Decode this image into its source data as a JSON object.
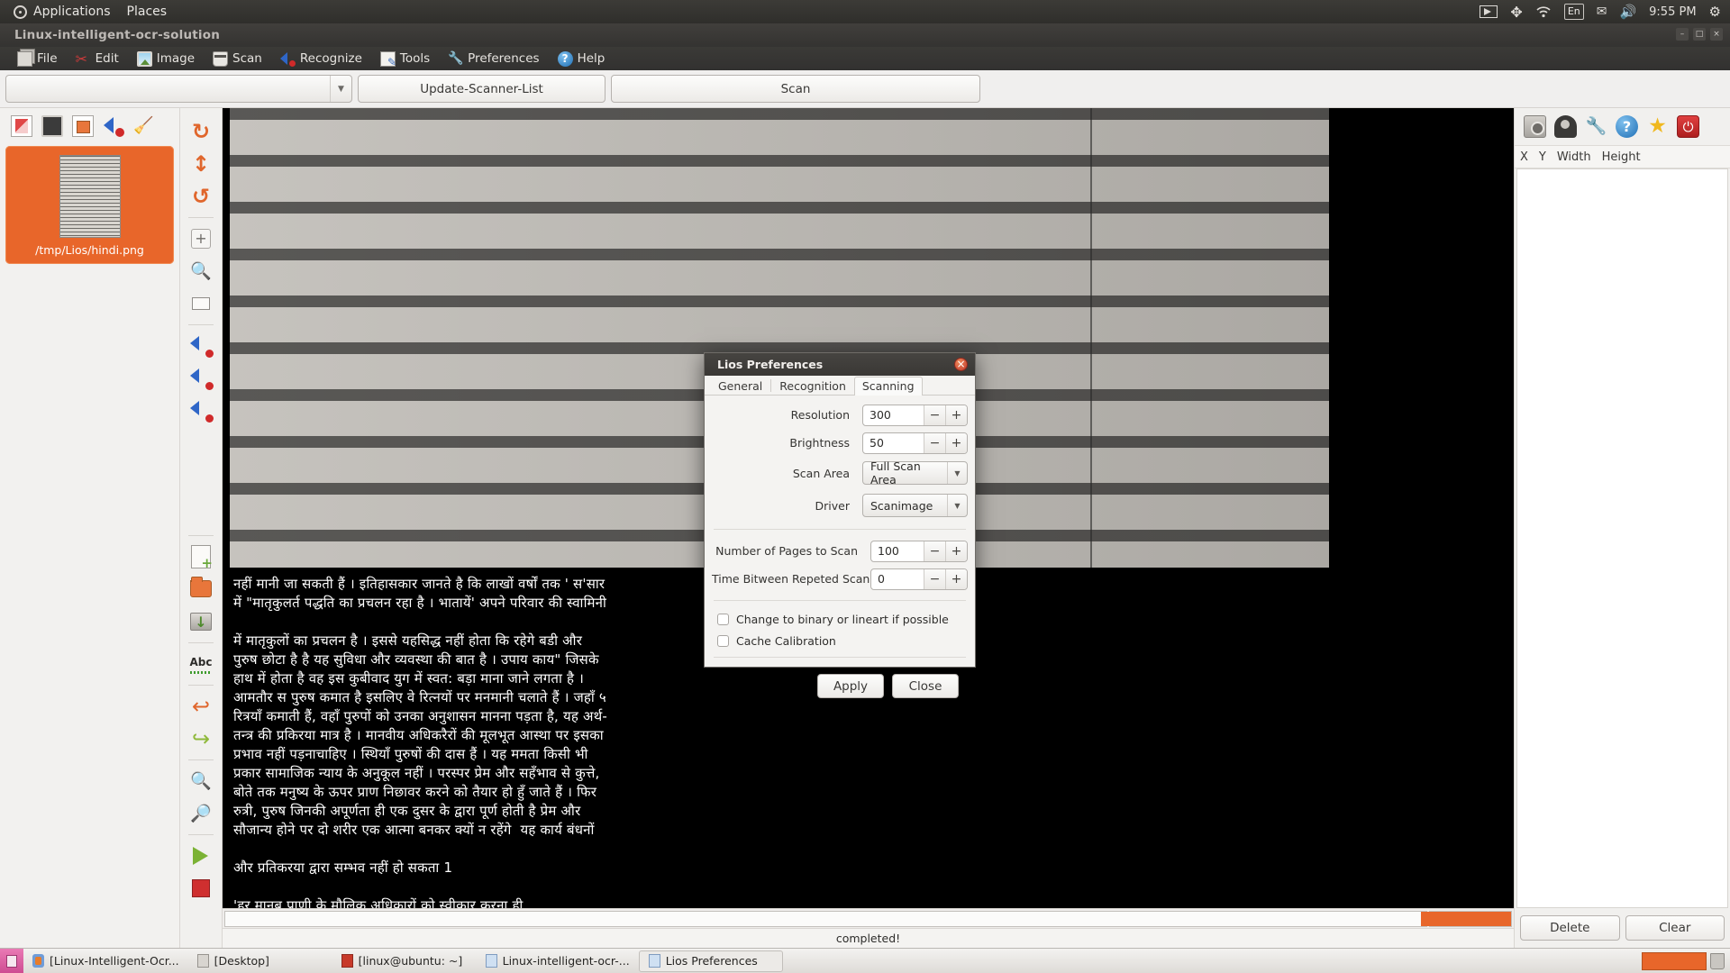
{
  "top_panel": {
    "applications": "Applications",
    "places": "Places",
    "logo_icon": "ubuntu-logo-icon",
    "tray": {
      "media_icon": "media-player-icon",
      "bluetooth_icon": "bluetooth-icon",
      "wifi_icon": "wifi-icon",
      "keyboard_layout": "En",
      "mail_icon": "mail-icon",
      "volume_icon": "volume-icon",
      "clock": "9:55 PM",
      "settings_icon": "gear-icon"
    }
  },
  "window": {
    "title": "Linux-intelligent-ocr-solution",
    "buttons": {
      "minimize": "–",
      "maximize": "□",
      "close": "×"
    }
  },
  "menubar": [
    {
      "label": "File",
      "icon": "file-icon"
    },
    {
      "label": "Edit",
      "icon": "scissors-icon"
    },
    {
      "label": "Image",
      "icon": "image-icon"
    },
    {
      "label": "Scan",
      "icon": "scanner-icon"
    },
    {
      "label": "Recognize",
      "icon": "recognize-icon"
    },
    {
      "label": "Tools",
      "icon": "tools-icon"
    },
    {
      "label": "Preferences",
      "icon": "preferences-icon"
    },
    {
      "label": "Help",
      "icon": "help-icon"
    }
  ],
  "scan_bar": {
    "device_combo_value": "",
    "device_combo_placeholder": "",
    "update_scanner_list": "Update-Scanner-List",
    "scan": "Scan"
  },
  "thumb_panel": {
    "tools": [
      "page-split-icon",
      "black-page-icon",
      "copy-page-icon",
      "recognize-page-icon",
      "clean-icon"
    ],
    "item_label": "/tmp/Lios/hindi.png",
    "item_icon": "page-thumbnail"
  },
  "side_rail": [
    "rotate-right-icon",
    "flip-vertical-icon",
    "rotate-left-icon",
    "add-area-icon",
    "zoom-icon",
    "select-area-icon",
    "recognize-area-icon",
    "recognize-area-2-icon",
    "recognize-area-3-icon",
    "new-document-icon",
    "open-folder-icon",
    "save-icon",
    "spellcheck-icon",
    "undo-icon",
    "redo-icon",
    "find-icon",
    "find-replace-icon",
    "play-icon",
    "stop-icon"
  ],
  "text_view": {
    "content": "नहीं मानी जा सकती हैं । इतिहासकार जानते है कि लाखों वर्षों तक ' स'सार\nमें \"मातृकुलर्त पद्धति का प्रचलन रहा है । भातायें' अपने परिवार की स्वामिनी\n\nमें मातृकुलों का प्रचलन है । इससे यहसिद्ध नहीं होता कि रहेगे बडी और\nपुरुष छोटा है है यह सुविधा और व्यवस्था की बात है । उपाय काय\" जिसके\nहाथ में होता है वह इस कुबीवाद युग में स्वत: बड़ा माना जाने लगता है ।\nआमतौर स पुरुष कमात है इसलिए वे रित्नयों पर मनमानी चलाते हैं । जहाँ ५\nरित्रयाँ कमाती हैं, वहाँ पुरुपों को उनका अनुशासन मानना पड़ता है, यह अर्थ-\nतन्त्र की प्रकिरया मात्र है । मानवीय अधिकरैरों की मूलभूत आस्था पर इसका\nप्रभाव नहीं पड़नाचाहिए । स्थियाँ पुरुषों की दास हैं । यह ममता किसी भी\nप्रकार सामाजिक न्याय के अनुकूल नहीं । परस्पर प्रेम और सहँभाव से कुत्ते,\nबोते तक मनुष्य के ऊपर प्राण निछावर करने को तैयार हो हुँ जाते हैं । फिर\nरुत्री, पुरुष जिनकी अपूर्णता ही एक दुसर के द्वारा पूर्ण होती है प्रेम और\nसौजान्य होने पर दो शरीर एक आत्मा बनकर क्यों न रहेंगे  यह कार्य बंधनों\n\nऔर प्रतिकरया द्वारा सम्भव नहीं हो सकता 1\n\n'हर मानब प्राणी के मौलिक अधिकारों को स्वीकार करना ही\nचाहिए । हर व्यक्ति समान नागरिक अधिकार लेकर जन्मना है इस तथ्य को"
  },
  "right_panel": {
    "tools": [
      "camera-icon",
      "webcam-icon",
      "settings-wrench-icon",
      "help-icon",
      "favorite-star-icon",
      "power-icon"
    ],
    "columns": [
      "X",
      "Y",
      "Width",
      "Height"
    ],
    "rows": [],
    "delete_button": "Delete",
    "clear_button": "Clear"
  },
  "status": {
    "message": "completed!"
  },
  "dialog": {
    "title": "Lios Preferences",
    "close_icon": "close-icon",
    "tabs": [
      {
        "label": "General",
        "active": false
      },
      {
        "label": "Recognition",
        "active": false
      },
      {
        "label": "Scanning",
        "active": true
      }
    ],
    "fields": [
      {
        "label": "Resolution",
        "value": "300",
        "type": "spin"
      },
      {
        "label": "Brightness",
        "value": "50",
        "type": "spin"
      },
      {
        "label": "Scan Area",
        "value": "Full Scan Area",
        "type": "select"
      },
      {
        "label": "Driver",
        "value": "Scanimage",
        "type": "select"
      }
    ],
    "fields2": [
      {
        "label": "Number of Pages to Scan",
        "value": "100",
        "type": "spin"
      },
      {
        "label": "Time Bitween Repeted Scanning",
        "value": "0",
        "type": "spin"
      }
    ],
    "checkboxes": [
      {
        "label": "Change to binary or lineart if possible",
        "checked": false
      },
      {
        "label": "Cache Calibration",
        "checked": false
      }
    ],
    "apply_button": "Apply",
    "close_button": "Close",
    "spin_minus": "−",
    "spin_plus": "+",
    "select_arrow": "▼"
  },
  "taskbar": {
    "show_desktop_icon": "show-desktop-icon",
    "tasks": [
      {
        "label": "[Linux-Intelligent-Ocr...",
        "icon": "firefox-icon",
        "active": false
      },
      {
        "label": "[Desktop]",
        "icon": "folder-icon",
        "active": false
      },
      {
        "label": "[linux@ubuntu: ~]",
        "icon": "terminal-icon",
        "active": false
      },
      {
        "label": "Linux-intelligent-ocr-...",
        "icon": "window-icon",
        "active": false
      },
      {
        "label": "Lios Preferences",
        "icon": "window-icon",
        "active": true
      }
    ]
  },
  "colors": {
    "accent_orange": "#e8662a",
    "panel_bg": "#f1f0ee",
    "dark_bar": "#3a3835",
    "text_view_bg": "#000000"
  }
}
